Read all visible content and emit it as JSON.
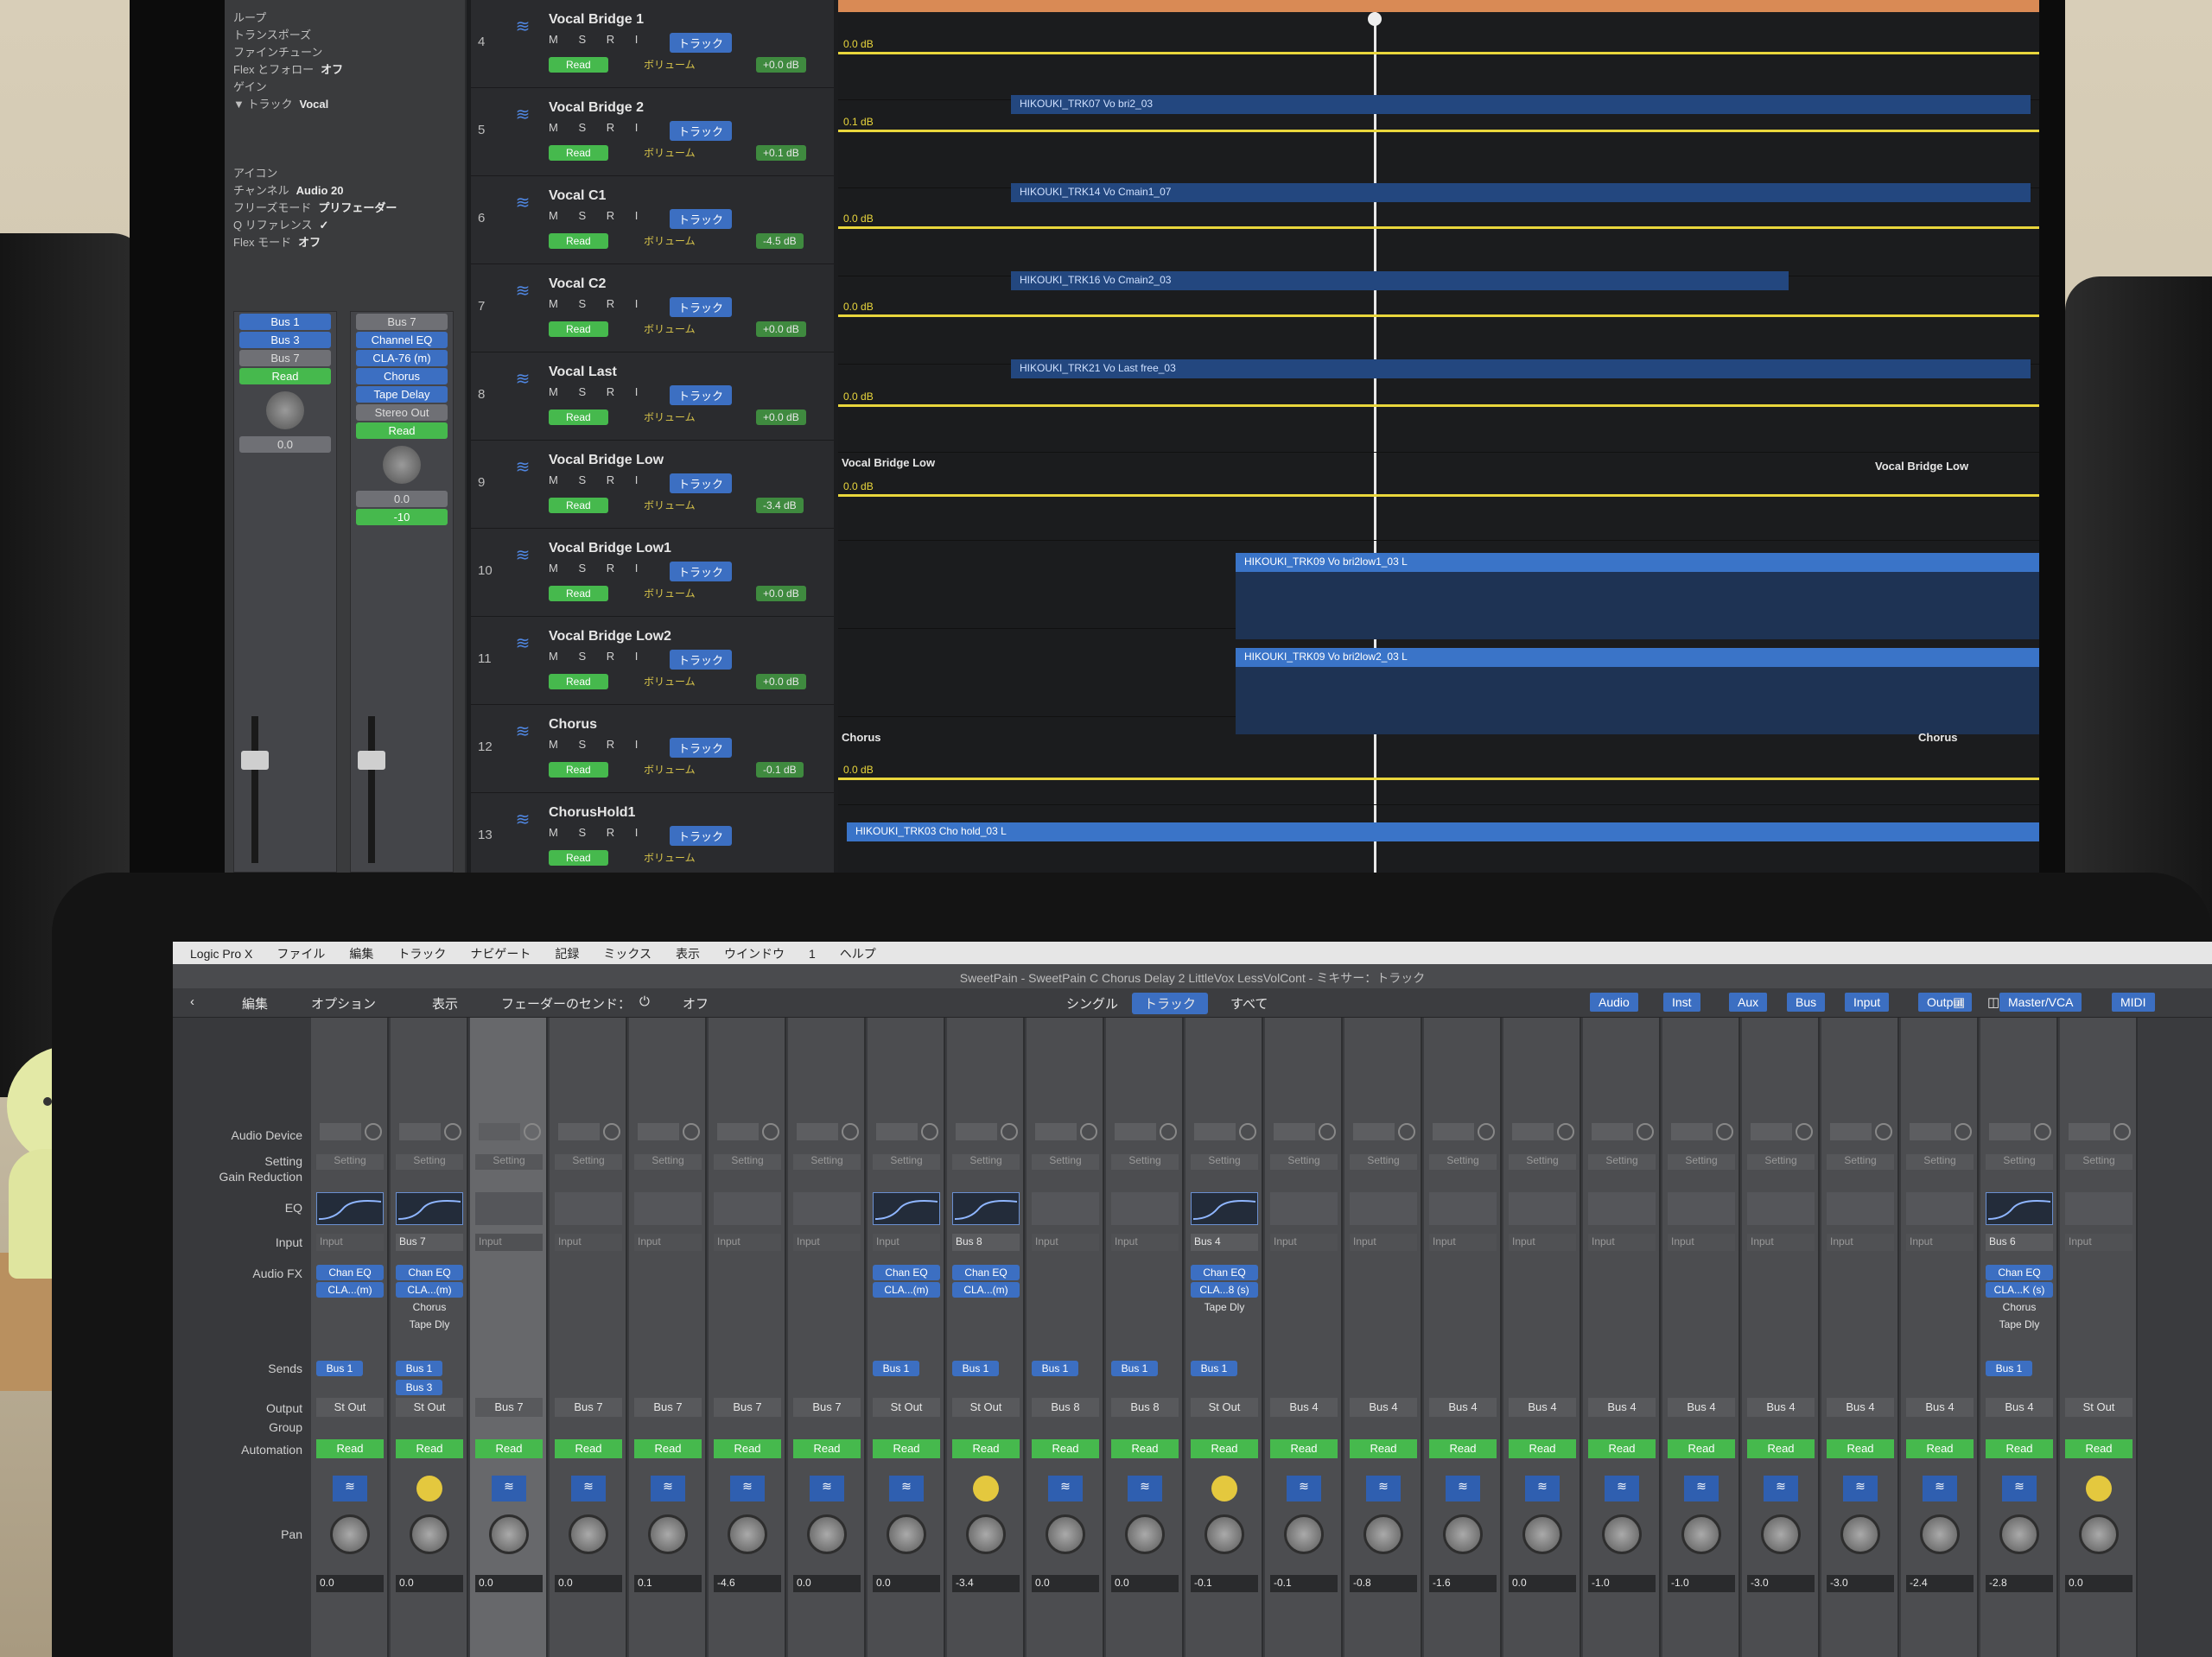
{
  "monitor": {
    "inspector": {
      "rows": [
        {
          "label": "ループ",
          "value": ""
        },
        {
          "label": "トランスポーズ",
          "value": ""
        },
        {
          "label": "ファインチューン",
          "value": ""
        },
        {
          "label": "Flex とフォロー",
          "value": "オフ"
        },
        {
          "label": "ゲイン",
          "value": ""
        },
        {
          "label": "▼ トラック",
          "value": "Vocal"
        },
        {
          "label": "アイコン",
          "value": ""
        },
        {
          "label": "チャンネル",
          "value": "Audio 20"
        },
        {
          "label": "フリーズモード",
          "value": "プリフェーダー"
        },
        {
          "label": "Q リファレンス",
          "value": "✓"
        },
        {
          "label": "Flex モード",
          "value": "オフ"
        }
      ],
      "strip_a": {
        "fx": [],
        "sends": [
          "Bus 1",
          "Bus 3"
        ],
        "output": "Bus 7",
        "automation": "Read",
        "vol": "0.0"
      },
      "strip_b": {
        "fx": [
          "Channel EQ",
          "CLA-76 (m)",
          "Chorus",
          "Tape Delay"
        ],
        "input": "Bus 7",
        "output": "Stereo Out",
        "automation": "Read",
        "vol": "0.0",
        "peak": "-10"
      }
    },
    "tracks": [
      {
        "num": "4",
        "name": "Vocal Bridge 1",
        "db": "+0.0 dB"
      },
      {
        "num": "5",
        "name": "Vocal Bridge 2",
        "db": "+0.1 dB"
      },
      {
        "num": "6",
        "name": "Vocal C1",
        "db": "-4.5 dB"
      },
      {
        "num": "7",
        "name": "Vocal C2",
        "db": "+0.0 dB"
      },
      {
        "num": "8",
        "name": "Vocal Last",
        "db": "+0.0 dB"
      },
      {
        "num": "9",
        "name": "Vocal Bridge Low",
        "db": "-3.4 dB"
      },
      {
        "num": "10",
        "name": "Vocal Bridge Low1",
        "db": "+0.0 dB"
      },
      {
        "num": "11",
        "name": "Vocal Bridge Low2",
        "db": "+0.0 dB"
      },
      {
        "num": "12",
        "name": "Chorus",
        "db": "-0.1 dB"
      },
      {
        "num": "13",
        "name": "ChorusHold1",
        "db": ""
      }
    ],
    "track_labels": {
      "msri": "M S R I",
      "track_btn": "トラック",
      "read": "Read",
      "vol": "ボリューム"
    },
    "regions": [
      {
        "text": "HIKOUKI_TRK07 Vo bri2_03"
      },
      {
        "text": "HIKOUKI_TRK14 Vo Cmain1_07"
      },
      {
        "text": "HIKOUKI_TRK16 Vo Cmain2_03"
      },
      {
        "text": "HIKOUKI_TRK21 Vo Last free_03"
      },
      {
        "text": "HIKOUKI_TRK09 Vo bri2low1_03 L"
      },
      {
        "text": "HIKOUKI_TRK09 Vo bri2low2_03 L"
      },
      {
        "text": "HIKOUKI_TRK03 Cho hold_03 L"
      }
    ],
    "lane_labels": {
      "bridge_low_left": "Vocal Bridge Low",
      "bridge_low_right": "Vocal Bridge Low",
      "chorus_left": "Chorus",
      "chorus_right": "Chorus"
    },
    "auto_values": [
      "0.0 dB",
      "0.1 dB",
      "0.0 dB",
      "0.0 dB",
      "0.0 dB",
      "0.0 dB",
      "0.0 dB"
    ]
  },
  "laptop": {
    "menubar": [
      "Logic Pro X",
      "ファイル",
      "編集",
      "トラック",
      "ナビゲート",
      "記録",
      "ミックス",
      "表示",
      "ウインドウ",
      "1",
      "ヘルプ"
    ],
    "title": "SweetPain - SweetPain C Chorus Delay 2 LittleVox LessVolCont - ミキサー：トラック",
    "toolbar": {
      "edit": "編集",
      "options": "オプション",
      "view": "表示",
      "fader_send": "フェーダーのセンド：",
      "off": "オフ",
      "seg_single": "シングル",
      "seg_track": "トラック",
      "seg_all": "すべて",
      "filters": [
        "Audio",
        "Inst",
        "Aux",
        "Bus",
        "Input",
        "Output",
        "Master/VCA",
        "MIDI"
      ]
    },
    "row_labels": {
      "audio_device": "Audio Device",
      "setting": "Setting",
      "gain_reduction": "Gain Reduction",
      "eq": "EQ",
      "input": "Input",
      "audio_fx": "Audio FX",
      "sends": "Sends",
      "output": "Output",
      "group": "Group",
      "automation": "Automation",
      "pan": "Pan"
    },
    "channels": [
      {
        "input": "Input",
        "fx": [
          "Chan EQ",
          "CLA...(m)"
        ],
        "sends": [
          "Bus 1"
        ],
        "output": "St Out",
        "auto": "Read",
        "icon": "wave",
        "eq": true,
        "vol": "0.0"
      },
      {
        "input": "Bus 7",
        "fx": [
          "Chan EQ",
          "CLA...(m)",
          "Chorus",
          "Tape Dly"
        ],
        "sends": [
          "Bus 1",
          "Bus 3"
        ],
        "output": "St Out",
        "auto": "Read",
        "icon": "dot",
        "eq": true,
        "vol": "0.0"
      },
      {
        "input": "Input",
        "fx": [],
        "sends": [],
        "output": "Bus 7",
        "auto": "Read",
        "icon": "wave",
        "eq": false,
        "vol": "0.0",
        "sel": true
      },
      {
        "input": "Input",
        "fx": [],
        "sends": [],
        "output": "Bus 7",
        "auto": "Read",
        "icon": "wave",
        "eq": false,
        "vol": "0.0"
      },
      {
        "input": "Input",
        "fx": [],
        "sends": [],
        "output": "Bus 7",
        "auto": "Read",
        "icon": "wave",
        "eq": false,
        "vol": "0.1"
      },
      {
        "input": "Input",
        "fx": [],
        "sends": [],
        "output": "Bus 7",
        "auto": "Read",
        "icon": "wave",
        "eq": false,
        "vol": "-4.6"
      },
      {
        "input": "Input",
        "fx": [],
        "sends": [],
        "output": "Bus 7",
        "auto": "Read",
        "icon": "wave",
        "eq": false,
        "vol": "0.0"
      },
      {
        "input": "Input",
        "fx": [
          "Chan EQ",
          "CLA...(m)"
        ],
        "sends": [
          "Bus 1"
        ],
        "output": "St Out",
        "auto": "Read",
        "icon": "wave",
        "eq": true,
        "vol": "0.0"
      },
      {
        "input": "Bus 8",
        "fx": [
          "Chan EQ",
          "CLA...(m)"
        ],
        "sends": [
          "Bus 1"
        ],
        "output": "St Out",
        "auto": "Read",
        "icon": "dot",
        "eq": true,
        "vol": "-3.4"
      },
      {
        "input": "Input",
        "fx": [],
        "sends": [
          "Bus 1"
        ],
        "output": "Bus 8",
        "auto": "Read",
        "icon": "wave",
        "eq": false,
        "vol": "0.0"
      },
      {
        "input": "Input",
        "fx": [],
        "sends": [
          "Bus 1"
        ],
        "output": "Bus 8",
        "auto": "Read",
        "icon": "wave",
        "eq": false,
        "vol": "0.0"
      },
      {
        "input": "Bus 4",
        "fx": [
          "Chan EQ",
          "CLA...8 (s)",
          "Tape Dly"
        ],
        "sends": [
          "Bus 1"
        ],
        "output": "St Out",
        "auto": "Read",
        "icon": "dot",
        "eq": true,
        "vol": "-0.1"
      },
      {
        "input": "Input",
        "fx": [],
        "sends": [],
        "output": "Bus 4",
        "auto": "Read",
        "icon": "wave",
        "eq": false,
        "vol": "-0.1"
      },
      {
        "input": "Input",
        "fx": [],
        "sends": [],
        "output": "Bus 4",
        "auto": "Read",
        "icon": "wave",
        "eq": false,
        "vol": "-0.8"
      },
      {
        "input": "Input",
        "fx": [],
        "sends": [],
        "output": "Bus 4",
        "auto": "Read",
        "icon": "wave",
        "eq": false,
        "vol": "-1.6"
      },
      {
        "input": "Input",
        "fx": [],
        "sends": [],
        "output": "Bus 4",
        "auto": "Read",
        "icon": "wave",
        "eq": false,
        "vol": "0.0"
      },
      {
        "input": "Input",
        "fx": [],
        "sends": [],
        "output": "Bus 4",
        "auto": "Read",
        "icon": "wave",
        "eq": false,
        "vol": "-1.0"
      },
      {
        "input": "Input",
        "fx": [],
        "sends": [],
        "output": "Bus 4",
        "auto": "Read",
        "icon": "wave",
        "eq": false,
        "vol": "-1.0"
      },
      {
        "input": "Input",
        "fx": [],
        "sends": [],
        "output": "Bus 4",
        "auto": "Read",
        "icon": "wave",
        "eq": false,
        "vol": "-3.0"
      },
      {
        "input": "Input",
        "fx": [],
        "sends": [],
        "output": "Bus 4",
        "auto": "Read",
        "icon": "wave",
        "eq": false,
        "vol": "-3.0"
      },
      {
        "input": "Input",
        "fx": [],
        "sends": [],
        "output": "Bus 4",
        "auto": "Read",
        "icon": "wave",
        "eq": false,
        "vol": "-2.4"
      },
      {
        "input": "Bus 6",
        "fx": [
          "Chan EQ",
          "CLA...K (s)",
          "Chorus",
          "Tape Dly"
        ],
        "sends": [
          "Bus 1"
        ],
        "output": "Bus 4",
        "auto": "Read",
        "icon": "wave",
        "eq": true,
        "vol": "-2.8"
      },
      {
        "input": "Input",
        "fx": [],
        "sends": [],
        "output": "St Out",
        "auto": "Read",
        "icon": "dot",
        "eq": false,
        "vol": "0.0"
      }
    ],
    "setting_label": "Setting",
    "colors": {
      "accent": "#3c6fc2",
      "read": "#46b94d",
      "automation": "#e9d63c"
    }
  }
}
